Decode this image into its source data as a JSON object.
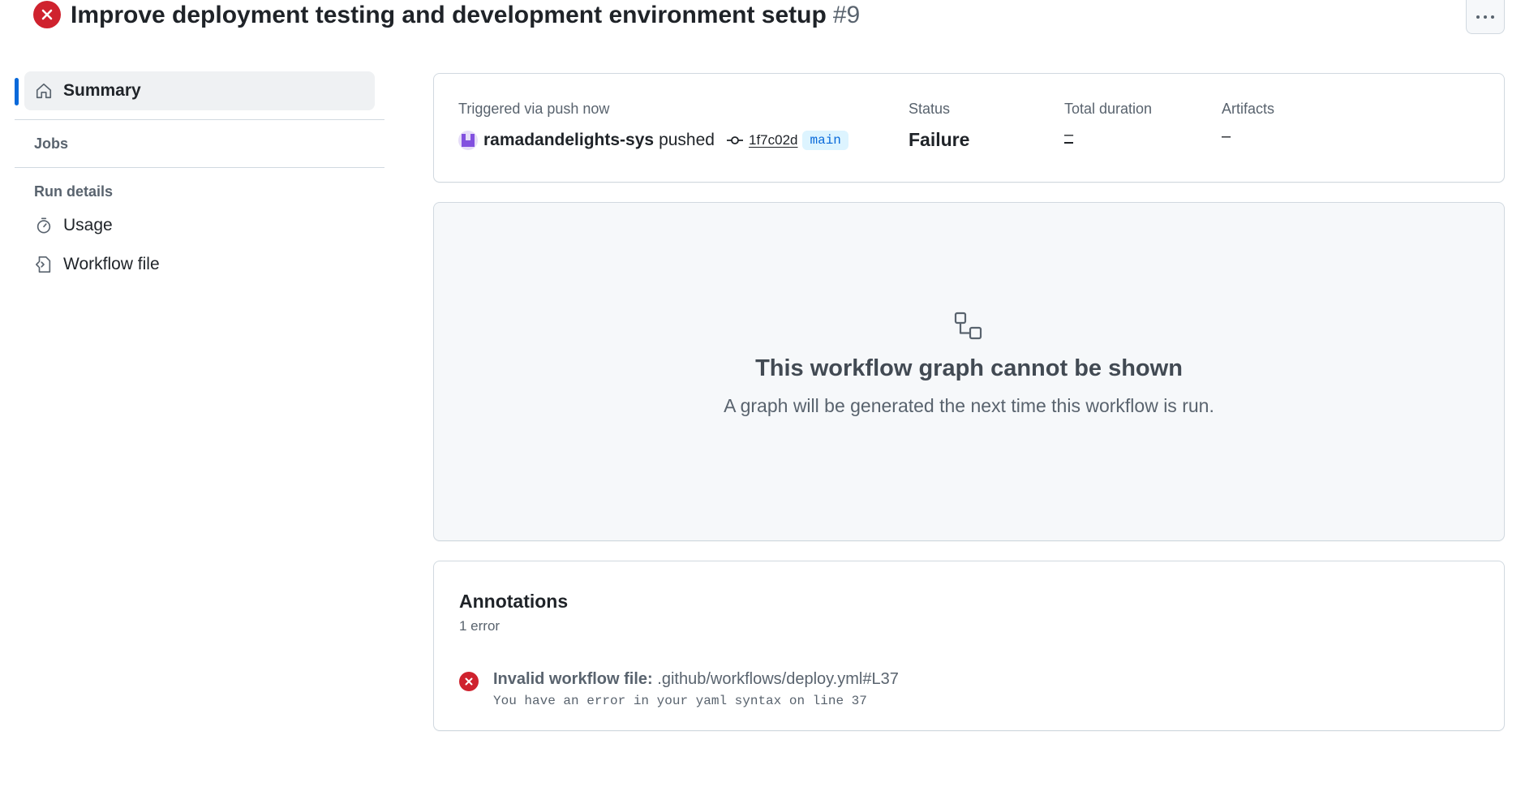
{
  "header": {
    "title": "Improve deployment testing and development environment setup",
    "run_number": "#9",
    "status_icon": "x-circle-fill-icon",
    "more_icon": "kebab-horizontal-icon"
  },
  "sidebar": {
    "summary_label": "Summary",
    "jobs_label": "Jobs",
    "run_details_label": "Run details",
    "items": [
      {
        "label": "Usage",
        "icon": "stopwatch-icon"
      },
      {
        "label": "Workflow file",
        "icon": "file-code-icon"
      }
    ]
  },
  "summary": {
    "trigger_label": "Triggered via push now",
    "actor": "ramadandelights-sys",
    "action": "pushed",
    "commit_sha": "1f7c02d",
    "branch": "main",
    "status_label": "Status",
    "status_value": "Failure",
    "duration_label": "Total duration",
    "duration_value": "–",
    "artifacts_label": "Artifacts",
    "artifacts_value": "–"
  },
  "graph": {
    "title": "This workflow graph cannot be shown",
    "subtitle": "A graph will be generated the next time this workflow is run."
  },
  "annotations": {
    "title": "Annotations",
    "count": "1 error",
    "items": [
      {
        "heading": "Invalid workflow file:",
        "path": ".github/workflows/deploy.yml#L37",
        "message": "You have an error in your yaml syntax on line 37"
      }
    ]
  },
  "colors": {
    "danger": "#cf222e",
    "accent": "#0969da",
    "muted": "#59636e",
    "border": "#d1d9e0"
  }
}
